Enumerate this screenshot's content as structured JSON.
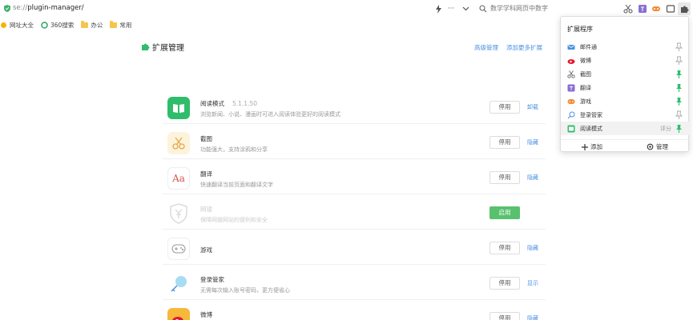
{
  "address_bar": {
    "protocol": "se://",
    "path": "plugin-manager/",
    "search_placeholder": "数学学科网页中数字"
  },
  "bookmarks": [
    {
      "label": "网址大全",
      "icon": "nav-icon"
    },
    {
      "label": "360搜索",
      "icon": "search-360-icon"
    },
    {
      "label": "办公",
      "icon": "folder-icon"
    },
    {
      "label": "常用",
      "icon": "folder-icon"
    }
  ],
  "page": {
    "title": "扩展管理",
    "advanced_link": "高级管理",
    "add_more_link": "添加更多扩展"
  },
  "extensions": [
    {
      "name": "阅读模式",
      "version": "5.1.1.50",
      "desc": "浏览新闻、小说、漫画时可进入阅读体验更好的阅读模式",
      "button": "停用",
      "action": "卸载",
      "icon": "book-icon",
      "state": "enabled"
    },
    {
      "name": "截图",
      "version": "",
      "desc": "功能强大，支持涂鸦和分享",
      "button": "停用",
      "action": "隐藏",
      "icon": "scissors-icon",
      "state": "enabled"
    },
    {
      "name": "翻译",
      "version": "",
      "desc": "快速翻译当前页面和翻译文字",
      "button": "停用",
      "action": "隐藏",
      "icon": "translate-icon",
      "state": "enabled"
    },
    {
      "name": "网银",
      "version": "",
      "desc": "保障网银网站的便利和安全",
      "button": "启用",
      "action": "",
      "icon": "yuan-shield-icon",
      "state": "disabled"
    },
    {
      "name": "游戏",
      "version": "",
      "desc": "",
      "button": "停用",
      "action": "隐藏",
      "icon": "gamepad-icon",
      "state": "enabled"
    },
    {
      "name": "登录管家",
      "version": "",
      "desc": "无需每次输入账号密码，更方便省心",
      "button": "停用",
      "action": "显示",
      "icon": "key-icon",
      "state": "enabled"
    },
    {
      "name": "微博",
      "version": "",
      "desc": "",
      "button": "停用",
      "action": "隐藏",
      "icon": "weibo-icon",
      "state": "enabled"
    }
  ],
  "popup": {
    "title": "扩展程序",
    "items": [
      {
        "name": "邮件通",
        "icon": "mail-icon",
        "color": "#4a90e2",
        "pinned": false,
        "score": ""
      },
      {
        "name": "微博",
        "icon": "weibo-icon",
        "color": "#e6162d",
        "pinned": false,
        "score": ""
      },
      {
        "name": "截图",
        "icon": "scissors-icon",
        "color": "#666666",
        "pinned": true,
        "score": ""
      },
      {
        "name": "翻译",
        "icon": "translate-icon",
        "color": "#8a6fd1",
        "pinned": true,
        "score": ""
      },
      {
        "name": "游戏",
        "icon": "gamepad-icon",
        "color": "#f28c38",
        "pinned": true,
        "score": ""
      },
      {
        "name": "登录管家",
        "icon": "key-icon",
        "color": "#4a90e2",
        "pinned": false,
        "score": ""
      },
      {
        "name": "阅读模式",
        "icon": "book-icon",
        "color": "#2fbd6b",
        "pinned": true,
        "score": "评分"
      }
    ],
    "add_label": "添加",
    "manage_label": "管理"
  },
  "colors": {
    "accent_green": "#58c16e",
    "link_blue": "#4a90e2",
    "pin_green": "#2fbd6b"
  }
}
